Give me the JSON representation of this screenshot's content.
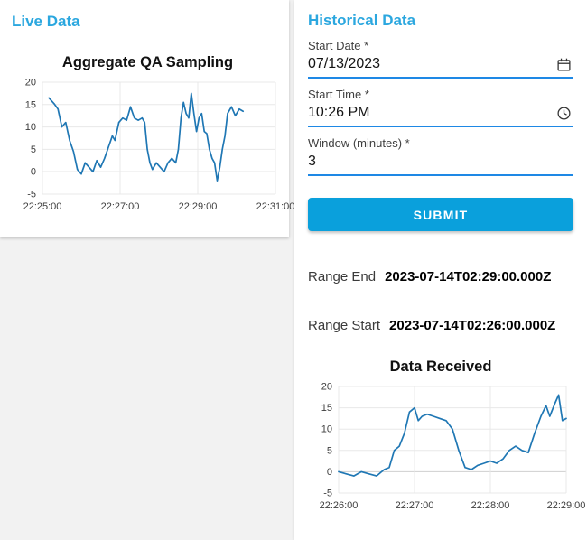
{
  "live_panel": {
    "title": "Live Data"
  },
  "historical_panel": {
    "title": "Historical Data",
    "form": {
      "start_date": {
        "label": "Start Date *",
        "value": "07/13/2023",
        "icon": "calendar-icon"
      },
      "start_time": {
        "label": "Start Time *",
        "value": "10:26 PM",
        "icon": "clock-icon"
      },
      "window": {
        "label": "Window (minutes) *",
        "value": "3"
      },
      "submit_label": "SUBMIT"
    },
    "range_end": {
      "label": "Range End",
      "value": "2023-07-14T02:29:00.000Z"
    },
    "range_start": {
      "label": "Range Start",
      "value": "2023-07-14T02:26:00.000Z"
    }
  },
  "colors": {
    "accent_heading": "#2ba7df",
    "submit_button": "#0aa0dc",
    "input_underline": "#1e88e5",
    "chart_line": "#1f77b4"
  },
  "chart_data": [
    {
      "type": "line",
      "title": "Aggregate QA Sampling",
      "xlabel": "",
      "ylabel": "",
      "grid": true,
      "legend": "none",
      "line_color": "#1f77b4",
      "x_unit": "seconds after 22:25:00",
      "xlim": [
        0,
        360
      ],
      "ylim": [
        -5,
        20
      ],
      "xticks": [
        0,
        120,
        240,
        360
      ],
      "xtick_labels": [
        "22:25:00",
        "22:27:00",
        "22:29:00",
        "22:31:00"
      ],
      "yticks": [
        -5,
        0,
        5,
        10,
        15,
        20
      ],
      "x": [
        10,
        18,
        24,
        30,
        36,
        42,
        48,
        54,
        60,
        66,
        72,
        78,
        84,
        90,
        96,
        102,
        108,
        112,
        118,
        124,
        130,
        136,
        142,
        148,
        154,
        158,
        162,
        166,
        170,
        176,
        182,
        188,
        194,
        200,
        206,
        210,
        214,
        218,
        222,
        226,
        230,
        234,
        238,
        242,
        246,
        250,
        254,
        258,
        262,
        266,
        270,
        274,
        278,
        282,
        286,
        292,
        298,
        304,
        310
      ],
      "y": [
        16.5,
        15.2,
        14,
        10,
        11,
        7,
        4.5,
        0.5,
        -0.5,
        2,
        1,
        0,
        2.5,
        1,
        3,
        5.5,
        8,
        7,
        11,
        12,
        11.5,
        14.5,
        12,
        11.5,
        12,
        11,
        5,
        2,
        0.5,
        2,
        1,
        0,
        2,
        3,
        2,
        5,
        12,
        15.5,
        13,
        12,
        17.5,
        13,
        9,
        12,
        13,
        9,
        8.5,
        5,
        3,
        2,
        -2,
        1,
        5,
        8,
        13,
        14.5,
        12.5,
        14,
        13.5
      ]
    },
    {
      "type": "line",
      "title": "Data Received",
      "xlabel": "",
      "ylabel": "",
      "grid": true,
      "legend": "none",
      "line_color": "#1f77b4",
      "x_unit": "seconds after 22:26:00",
      "xlim": [
        0,
        180
      ],
      "ylim": [
        -5,
        20
      ],
      "xticks": [
        0,
        60,
        120,
        180
      ],
      "xtick_labels": [
        "22:26:00",
        "22:27:00",
        "22:28:00",
        "22:29:00"
      ],
      "yticks": [
        -5,
        0,
        5,
        10,
        15,
        20
      ],
      "x": [
        0,
        6,
        12,
        18,
        24,
        30,
        36,
        40,
        44,
        48,
        52,
        56,
        60,
        63,
        66,
        70,
        75,
        80,
        85,
        90,
        95,
        100,
        105,
        110,
        115,
        120,
        125,
        130,
        135,
        140,
        145,
        150,
        155,
        160,
        164,
        167,
        171,
        174,
        177,
        180
      ],
      "y": [
        0,
        -0.5,
        -1,
        0,
        -0.5,
        -1,
        0.5,
        1,
        5,
        6,
        9,
        14,
        15,
        12,
        13,
        13.5,
        13,
        12.5,
        12,
        10,
        5,
        1,
        0.5,
        1.5,
        2,
        2.5,
        2,
        3,
        5,
        6,
        5,
        4.5,
        9,
        13,
        15.5,
        13,
        16,
        18,
        12,
        12.5
      ]
    }
  ]
}
